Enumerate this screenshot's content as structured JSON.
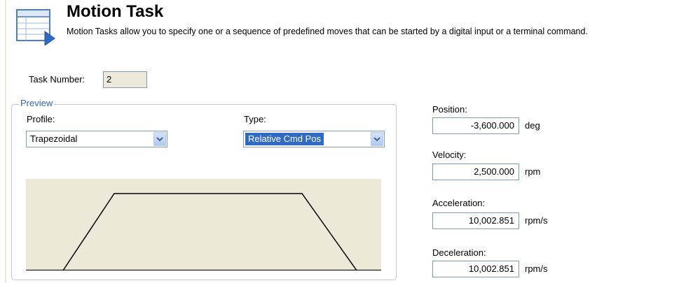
{
  "header": {
    "title": "Motion Task",
    "subtitle": "Motion Tasks allow you to specify one or a sequence of predefined moves that can be started by a digital input or a terminal command."
  },
  "task": {
    "label": "Task Number:",
    "value": "2"
  },
  "preview": {
    "legend": "Preview",
    "profile": {
      "label": "Profile:",
      "value": "Trapezoidal"
    },
    "type": {
      "label": "Type:",
      "value": "Relative Cmd Pos"
    }
  },
  "params": {
    "position": {
      "label": "Position:",
      "value": "-3,600.000",
      "unit": "deg"
    },
    "velocity": {
      "label": "Velocity:",
      "value": "2,500.000",
      "unit": "rpm"
    },
    "acceleration": {
      "label": "Acceleration:",
      "value": "10,002.851",
      "unit": "rpm/s"
    },
    "deceleration": {
      "label": "Deceleration:",
      "value": "10,002.851",
      "unit": "rpm/s"
    }
  },
  "colors": {
    "plot_background": "#ece9d8",
    "selection": "#316ac5",
    "input_border": "#7f9db9",
    "legend": "#3166b4"
  },
  "icons": {
    "header": "table-arrow-icon",
    "dropdown": "chevron-down-icon"
  }
}
